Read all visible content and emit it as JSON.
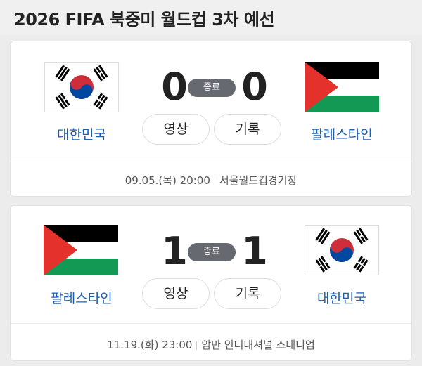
{
  "header": {
    "title": "2026 FIFA 북중미 월드컵 3차 예선"
  },
  "colors": {
    "accent": "#1a5fb4",
    "badge": "#666a70",
    "palestine_red": "#e4312b",
    "palestine_green": "#149954"
  },
  "matches": [
    {
      "home": {
        "name": "대한민국",
        "flag": "korea-flag"
      },
      "away": {
        "name": "팔레스타인",
        "flag": "palestine-flag"
      },
      "home_score": "0",
      "away_score": "0",
      "status": "종료",
      "video_label": "영상",
      "record_label": "기록",
      "datetime": "09.05.(목) 20:00",
      "venue": "서울월드컵경기장"
    },
    {
      "home": {
        "name": "팔레스타인",
        "flag": "palestine-flag"
      },
      "away": {
        "name": "대한민국",
        "flag": "korea-flag"
      },
      "home_score": "1",
      "away_score": "1",
      "status": "종료",
      "video_label": "영상",
      "record_label": "기록",
      "datetime": "11.19.(화) 23:00",
      "venue": "암만 인터내셔널 스태디엄"
    }
  ]
}
